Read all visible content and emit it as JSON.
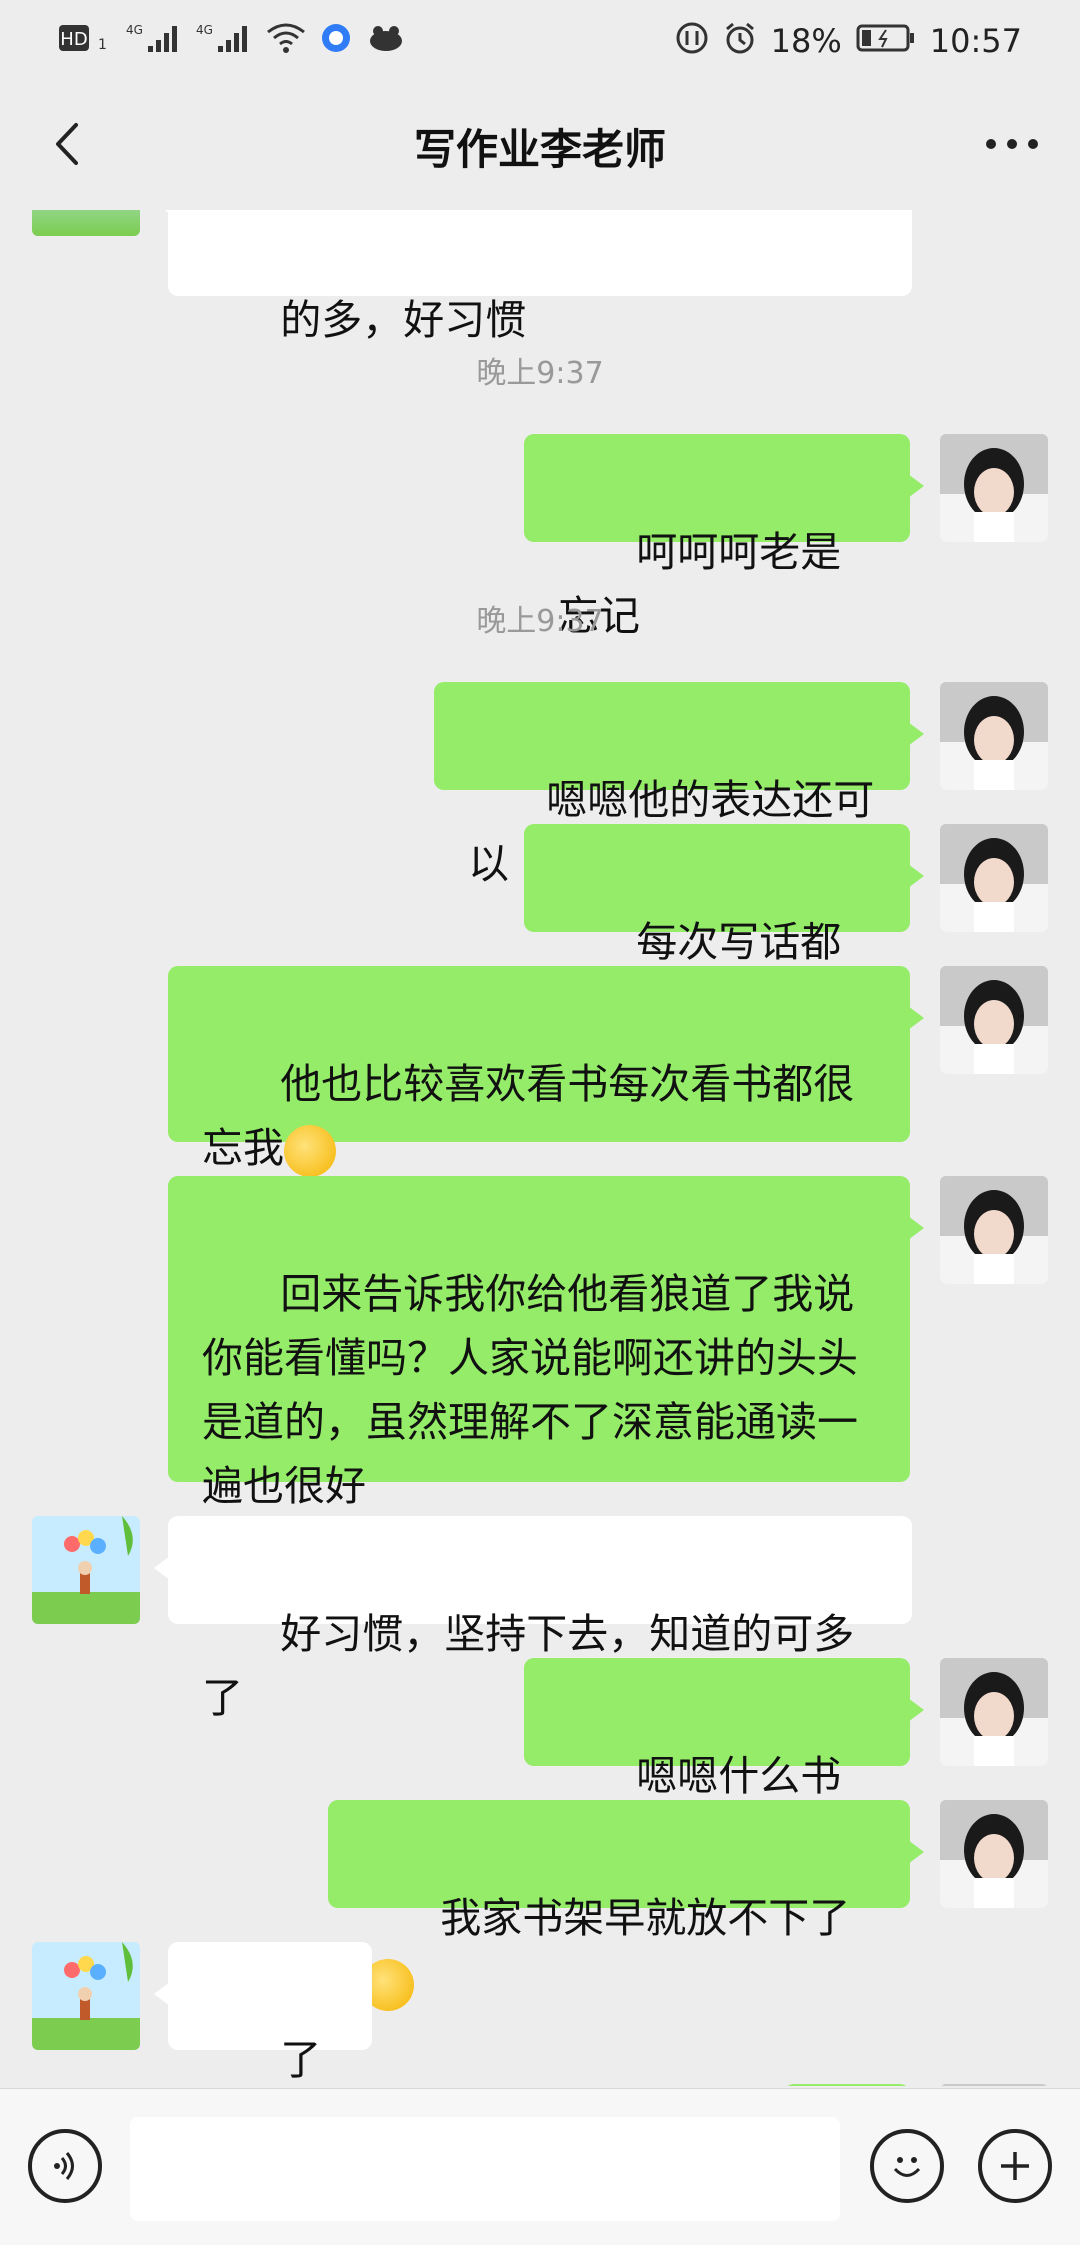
{
  "status": {
    "time": "10:57",
    "battery": "18%"
  },
  "nav": {
    "title": "写作业李老师"
  },
  "messages": {
    "m0": "的多，好习惯",
    "ts1": "晚上9:37",
    "m1": "呵呵呵老是忘记",
    "ts2": "晚上9:37",
    "m2": "嗯嗯他的表达还可以",
    "m3": "每次写话都不错",
    "m4": "他也比较喜欢看书每次看书都很忘我",
    "m5": "回来告诉我你给他看狼道了我说你能看懂吗？人家说能啊还讲的头头是道的，虽然理解不了深意能通读一遍也很好",
    "m6": "好习惯，坚持下去，知道的可多了",
    "m7": "嗯嗯什么书都看",
    "m8": "我家书架早就放不下了",
    "m9": "了不起"
  },
  "icons": {
    "back": "chevron-left-icon",
    "more": "more-icon",
    "voice": "voice-icon",
    "emoji": "emoji-icon",
    "plus": "plus-icon"
  },
  "colors": {
    "my_bubble": "#95ec69",
    "their_bubble": "#ffffff",
    "background": "#ededed"
  }
}
